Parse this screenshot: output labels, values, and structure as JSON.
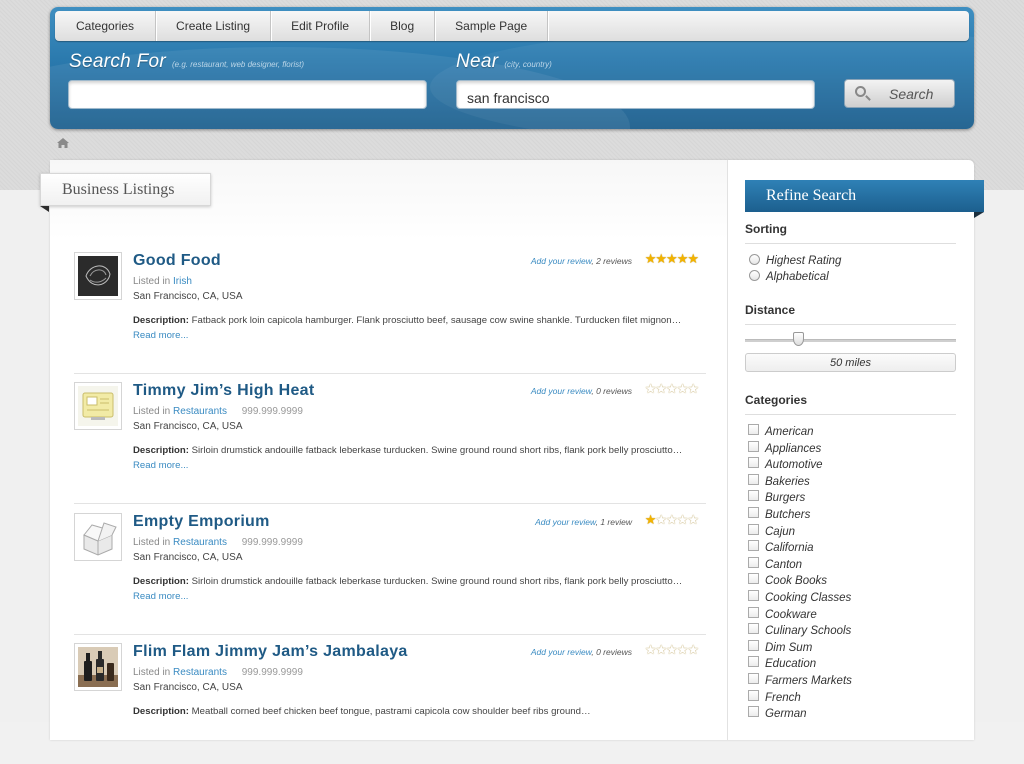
{
  "nav": [
    "Categories",
    "Create Listing",
    "Edit Profile",
    "Blog",
    "Sample Page"
  ],
  "search": {
    "for_label": "Search For",
    "for_hint": "(e.g. restaurant, web designer, florist)",
    "for_value": "",
    "near_label": "Near",
    "near_hint": "(city, country)",
    "near_value": "san francisco",
    "button": "Search"
  },
  "listings_title": "Business Listings",
  "listings": [
    {
      "title": "Good Food",
      "listed_in": "Listed in",
      "category": "Irish",
      "phone": "",
      "address": "San Francisco, CA, USA",
      "desc_label": "Description:",
      "desc": "Fatback pork loin capicola hamburger. Flank prosciutto beef, sausage cow swine shankle. Turducken filet mignon…",
      "more": "Read more...",
      "add_review": "Add your review",
      "reviews": ", 2 reviews",
      "rating": 5,
      "icon": "chalkboard-icon"
    },
    {
      "title": "Timmy Jim’s High Heat",
      "listed_in": "Listed in",
      "category": "Restaurants",
      "phone": "999.999.9999",
      "address": "San Francisco, CA, USA",
      "desc_label": "Description:",
      "desc": "Sirloin drumstick andouille fatback leberkase turducken. Swine ground round short ribs, flank pork belly prosciutto…",
      "more": "Read more...",
      "add_review": "Add your review",
      "reviews": ", 0 reviews",
      "rating": 0,
      "icon": "certificate-icon"
    },
    {
      "title": "Empty Emporium",
      "listed_in": "Listed in",
      "category": "Restaurants",
      "phone": "999.999.9999",
      "address": "San Francisco, CA, USA",
      "desc_label": "Description:",
      "desc": "Sirloin drumstick andouille fatback leberkase turducken. Swine ground round short ribs, flank pork belly prosciutto…",
      "more": "Read more...",
      "add_review": "Add your review",
      "reviews": ", 1 review",
      "rating": 1,
      "icon": "open-box-icon"
    },
    {
      "title": "Flim Flam Jimmy Jam’s Jambalaya",
      "listed_in": "Listed in",
      "category": "Restaurants",
      "phone": "999.999.9999",
      "address": "San Francisco, CA, USA",
      "desc_label": "Description:",
      "desc": "Meatball corned beef chicken beef tongue, pastrami capicola cow shoulder beef ribs ground…",
      "more": "",
      "add_review": "Add your review",
      "reviews": ", 0 reviews",
      "rating": 0,
      "icon": "bottles-icon"
    }
  ],
  "sidebar": {
    "title": "Refine Search",
    "sorting_label": "Sorting",
    "sorting_options": [
      "Highest Rating",
      "Alphabetical"
    ],
    "distance_label": "Distance",
    "distance_value": "50 miles",
    "distance_fraction": 0.25,
    "categories_label": "Categories",
    "categories": [
      "American",
      "Appliances",
      "Automotive",
      "Bakeries",
      "Burgers",
      "Butchers",
      "Cajun",
      "California",
      "Canton",
      "Cook Books",
      "Cooking Classes",
      "Cookware",
      "Culinary Schools",
      "Dim Sum",
      "Education",
      "Farmers Markets",
      "French",
      "German"
    ]
  }
}
